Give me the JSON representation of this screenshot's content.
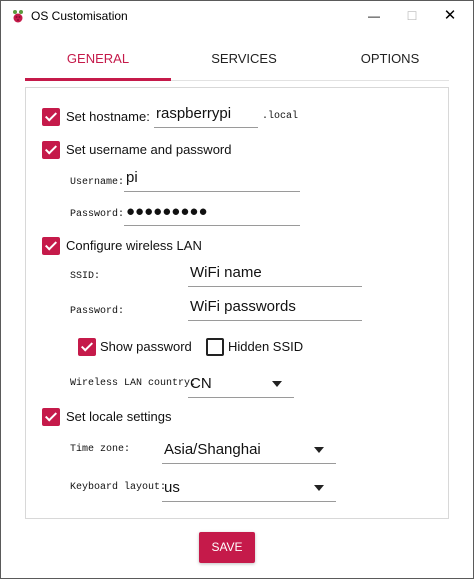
{
  "window": {
    "title": "OS Customisation",
    "min_glyph": "—",
    "max_glyph": "☐",
    "close_glyph": "✕"
  },
  "tabs": [
    {
      "label": "GENERAL",
      "active": true
    },
    {
      "label": "SERVICES",
      "active": false
    },
    {
      "label": "OPTIONS",
      "active": false
    }
  ],
  "general": {
    "hostname": {
      "label": "Set hostname:",
      "checked": true,
      "value": "raspberrypi",
      "suffix": ".local"
    },
    "user": {
      "label": "Set username and password",
      "checked": true,
      "username_label": "Username:",
      "username_value": "pi",
      "password_label": "Password:",
      "password_value": "●●●●●●●●●"
    },
    "wlan": {
      "label": "Configure wireless LAN",
      "checked": true,
      "ssid_label": "SSID:",
      "ssid_value": "WiFi name",
      "password_label": "Password:",
      "password_value": "WiFi passwords",
      "show_password": {
        "label": "Show password",
        "checked": true
      },
      "hidden_ssid": {
        "label": "Hidden SSID",
        "checked": false
      },
      "country_label": "Wireless LAN country:",
      "country_value": "CN"
    },
    "locale": {
      "label": "Set locale settings",
      "checked": true,
      "timezone_label": "Time zone:",
      "timezone_value": "Asia/Shanghai",
      "keyboard_label": "Keyboard layout:",
      "keyboard_value": "us"
    }
  },
  "save_label": "SAVE",
  "colors": {
    "accent": "#c51a4a"
  }
}
